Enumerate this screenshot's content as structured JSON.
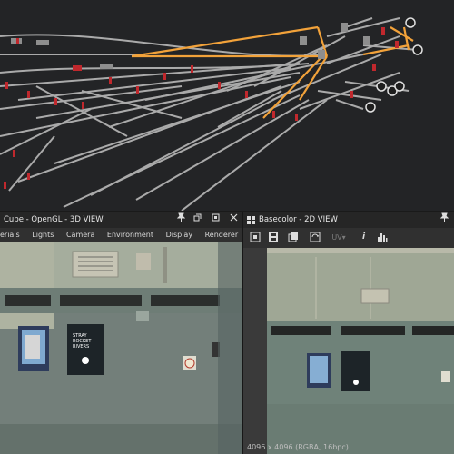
{
  "graph": {
    "colors": {
      "background": "#232426",
      "link": "#b9b9b9",
      "highlight": "#f2a23a",
      "node_red": "#c0282d"
    }
  },
  "view3d": {
    "title": "Cube - OpenGL - 3D VIEW",
    "menu": [
      "erials",
      "Lights",
      "Camera",
      "Environment",
      "Display",
      "Renderer"
    ],
    "controls": {
      "pin": "pin-icon",
      "float": "float-icon",
      "maximize": "maximize-icon",
      "close": "close-icon"
    }
  },
  "view2d": {
    "title": "Basecolor - 2D VIEW",
    "toolbar": {
      "uv_label": "UV",
      "uv_caret": "▾",
      "icons": [
        "fit-view-icon",
        "save-icon",
        "copy-icon",
        "refresh-icon",
        "uv-icon",
        "info-icon",
        "histogram-icon"
      ]
    },
    "status": "4096 x 4096 (RGBA, 16bpc)"
  },
  "texture": {
    "colors": {
      "wall": "#6f8279",
      "upper": "#9ea897",
      "vent": "#2a2a2a",
      "plate": "#c9c6b6"
    },
    "poster2_lines": [
      "STRAY",
      "ROCKET",
      "RIVERS"
    ]
  }
}
